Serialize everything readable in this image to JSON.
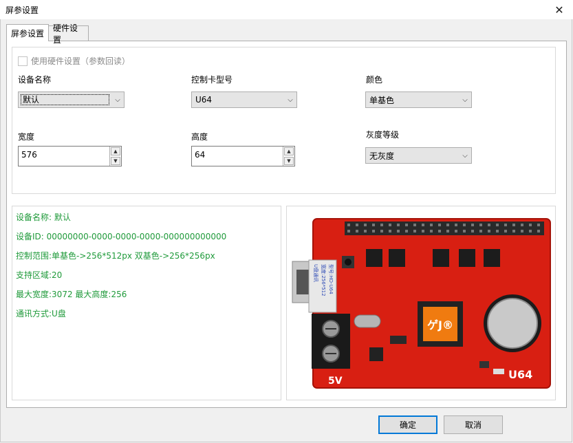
{
  "window": {
    "title": "屏参设置",
    "close_glyph": "✕"
  },
  "tabs": [
    {
      "label": "屏参设置",
      "active": true
    },
    {
      "label": "硬件设置",
      "active": false
    }
  ],
  "form": {
    "use_hardware_checkbox": {
      "label": "使用硬件设置（参数回读）",
      "checked": false,
      "enabled": false
    },
    "device_name": {
      "label": "设备名称",
      "value": "默认"
    },
    "card_model": {
      "label": "控制卡型号",
      "value": "U64"
    },
    "color": {
      "label": "颜色",
      "value": "单基色"
    },
    "width": {
      "label": "宽度",
      "value": "576"
    },
    "height": {
      "label": "高度",
      "value": "64"
    },
    "gray_level": {
      "label": "灰度等级",
      "value": "无灰度"
    }
  },
  "info": {
    "lines": [
      "设备名称: 默认",
      "设备ID:  00000000-0000-0000-0000-000000000000",
      "控制范围:单基色->256*512px  双基色->256*256px",
      "支持区域:20",
      "最大宽度:3072 最大高度:256",
      "通讯方式:U盘"
    ],
    "text_color": "#1f9a3a"
  },
  "board_image": {
    "description_icon": "controller-board-image",
    "usb_label_lines": [
      "U盘通讯",
      "宽度:256*512",
      "型号:HD-U64"
    ],
    "chip_logo": "ゲJ®",
    "model_mark": "U64",
    "voltage_mark": "5V",
    "pcb_color": "#d81f12"
  },
  "buttons": {
    "ok": "确定",
    "cancel": "取消"
  }
}
